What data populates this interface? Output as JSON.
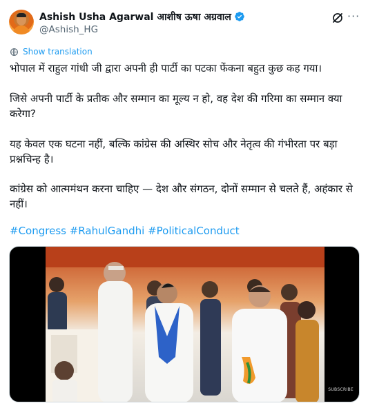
{
  "author": {
    "display_name": "Ashish Usha Agarwal आशीष ऊषा अग्रवाल",
    "handle": "@Ashish_HG",
    "verified": true
  },
  "actions": {
    "grok_icon": "grok-icon",
    "more_icon": "more-icon"
  },
  "translate": {
    "label": "Show translation",
    "icon": "globe-icon"
  },
  "body": {
    "p1": "भोपाल में राहुल गांधी जी द्वारा अपनी ही पार्टी का पटका फेंकना बहुत कुछ कह गया।",
    "p2": "जिसे अपनी पार्टी के प्रतीक और सम्मान का मूल्य न हो, वह देश की गरिमा का सम्मान क्या करेगा?",
    "p3": "यह केवल एक घटना नहीं, बल्कि कांग्रेस की अस्थिर सोच और नेतृत्व की गंभीरता पर बड़ा प्रश्नचिन्ह है।",
    "p4": "कांग्रेस को आत्ममंथन करना चाहिए — देश और संगठन, दोनों सम्मान से चलते हैं, अहंकार से नहीं।"
  },
  "hashtags": [
    "#Congress",
    "#RahulGandhi",
    "#PoliticalConduct"
  ],
  "media": {
    "overlay_text": "SUBSCRIBE"
  },
  "colors": {
    "accent": "#1d9bf0",
    "text": "#0f1419",
    "muted": "#536471"
  }
}
